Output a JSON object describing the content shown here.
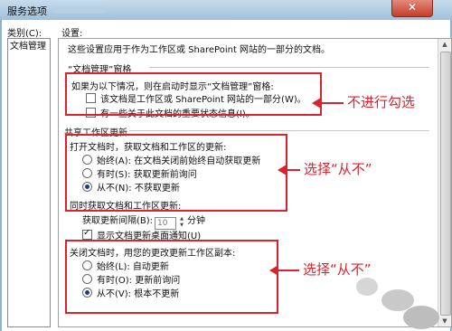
{
  "window": {
    "title": "服务选项",
    "close_glyph": "✕"
  },
  "category": {
    "label": "类别(C):",
    "items": [
      "文档管理"
    ]
  },
  "settings": {
    "label": "设置:",
    "description": "这些设置应用于作为工作区或 SharePoint 网站的一部分的文档。",
    "pane_section": {
      "title": "“文档管理”窗格",
      "intro": "如果为以下情况，则在启动时显示“文档管理”窗格:",
      "opt_workspace": "该文档是工作区或 SharePoint 网站的一部分(W)。",
      "opt_status": "有一些关于此文档的重要状态信息(I)。"
    },
    "shared_section": {
      "title": "共享工作区更新",
      "open_intro": "打开文档时，获取文档和工作区的更新:",
      "open_always": "始终(A):   在文档关闭前始终自动获取更新",
      "open_sometimes": "有时(S):   获取更新前询问",
      "open_never": "从不(N):   不获取更新",
      "periodic_intro": "同时获取文档和工作区更新:",
      "interval_label": "获取更新间隔(B):",
      "interval_value": "10",
      "interval_unit": "分钟",
      "notify": "显示文档更新桌面通知(U)",
      "close_intro": "关闭文档时，用您的更改更新工作区副本:",
      "close_always": "始终(L):   自动更新",
      "close_sometimes": "有时(O):   更新前询问",
      "close_never": "从不(V):   根本不更新"
    }
  },
  "annotations": {
    "no_check": "不进行勾选",
    "select_never_1": "选择“从不”",
    "select_never_2": "选择“从不”"
  },
  "colors": {
    "annotation_red": "#d9232e",
    "titlebar": "#a9c6de"
  }
}
